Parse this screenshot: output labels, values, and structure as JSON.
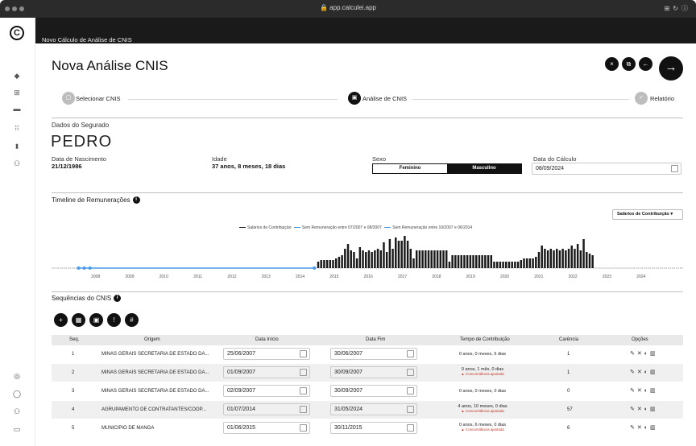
{
  "browser": {
    "url": "app.calculei.app"
  },
  "breadcrumb": "Novo Cálculo de Análise de CNIS",
  "page": {
    "title": "Nova Análise CNIS"
  },
  "header_buttons": {
    "close": "×",
    "copy": "⧉",
    "back": "←",
    "next": "→"
  },
  "steps": [
    {
      "label": "Selecionar CNIS",
      "state": "done"
    },
    {
      "label": "Análise de CNIS",
      "state": "active"
    },
    {
      "label": "Relatório",
      "state": "pending"
    }
  ],
  "segurado": {
    "section_title": "Dados do Segurado",
    "name": "PEDRO",
    "birth_label": "Data de Nascimento",
    "birth_value": "21/12/1986",
    "age_label": "Idade",
    "age_value": "37 anos, 8 meses, 18 dias",
    "sex_label": "Sexo",
    "sex_options": [
      "Feminino",
      "Masculino"
    ],
    "sex_selected": "Masculino",
    "calc_date_label": "Data do Cálculo",
    "calc_date_value": "08/09/2024"
  },
  "timeline": {
    "title": "Timeline de Remunerações",
    "dropdown": "Salários de Contribuição ▾",
    "legend": [
      {
        "name": "Salários de Contribuição",
        "color": "#222222"
      },
      {
        "name": "Sem Remuneração entre 07/2007 e 08/2007",
        "color": "#4a9be8"
      },
      {
        "name": "Sem Remuneração entre 10/2007 e 06/2014",
        "color": "#4a9be8"
      }
    ],
    "years": [
      "2008",
      "2009",
      "2010",
      "2011",
      "2012",
      "2013",
      "2014",
      "2015",
      "2016",
      "2017",
      "2018",
      "2019",
      "2020",
      "2021",
      "2022",
      "2023",
      "2024"
    ]
  },
  "chart_data": {
    "type": "bar",
    "x_start": "2007-06",
    "x_end": "2024-09",
    "gap_line_from": "2007-07",
    "gap_line_to": "2014-06",
    "bars": [
      0.2,
      0.25,
      0.25,
      0.25,
      0.25,
      0.25,
      0.3,
      0.35,
      0.4,
      0.6,
      0.75,
      0.55,
      0.5,
      0.3,
      0.65,
      0.55,
      0.5,
      0.55,
      0.5,
      0.55,
      0.6,
      0.55,
      0.8,
      0.5,
      0.9,
      0.6,
      0.95,
      0.85,
      0.85,
      1.0,
      0.85,
      0.6,
      0.3,
      0.55,
      0.55,
      0.55,
      0.55,
      0.55,
      0.55,
      0.55,
      0.55,
      0.55,
      0.55,
      0.55,
      0.2,
      0.4,
      0.4,
      0.4,
      0.4,
      0.4,
      0.4,
      0.4,
      0.4,
      0.4,
      0.4,
      0.4,
      0.4,
      0.4,
      0.4,
      0.2,
      0.2,
      0.2,
      0.2,
      0.2,
      0.2,
      0.2,
      0.2,
      0.2,
      0.25,
      0.3,
      0.3,
      0.3,
      0.3,
      0.35,
      0.5,
      0.7,
      0.6,
      0.55,
      0.6,
      0.55,
      0.6,
      0.55,
      0.6,
      0.55,
      0.6,
      0.7,
      0.6,
      0.75,
      0.55,
      0.9,
      0.5,
      0.45,
      0.4
    ]
  },
  "sequencias": {
    "title": "Sequências do CNIS",
    "tools": [
      "+",
      "▦",
      "▣",
      "!",
      "#"
    ],
    "headers": [
      "Seq.",
      "Origem",
      "Data Início",
      "Data Fim",
      "Tempo de Contribuição",
      "Carência",
      "Opções"
    ],
    "rows": [
      {
        "seq": "1",
        "origem": "MINAS GERAIS SECRETARIA DE ESTADO DA...",
        "inicio": "25/06/2007",
        "fim": "30/06/2007",
        "tempo": "0 anos, 0 meses, 6 dias",
        "conc": "",
        "carencia": "1"
      },
      {
        "seq": "2",
        "origem": "MINAS GERAIS SECRETARIA DE ESTADO DA...",
        "inicio": "01/09/2007",
        "fim": "30/09/2007",
        "tempo": "0 anos, 1 mês, 0 dias",
        "conc": "▲ Concomitância ajustada",
        "carencia": "1"
      },
      {
        "seq": "3",
        "origem": "MINAS GERAIS SECRETARIA DE ESTADO DA...",
        "inicio": "02/09/2007",
        "fim": "30/09/2007",
        "tempo": "0 anos, 0 meses, 0 dias",
        "conc": "",
        "carencia": "0"
      },
      {
        "seq": "4",
        "origem": "AGRUPAMENTO DE CONTRATANTES/COOP...",
        "inicio": "01/07/2014",
        "fim": "31/05/2024",
        "tempo": "4 anos, 10 meses, 0 dias",
        "conc": "▲ Concomitância ajustada",
        "carencia": "57"
      },
      {
        "seq": "5",
        "origem": "MUNICIPIO DE MANGA",
        "inicio": "01/06/2015",
        "fim": "30/11/2015",
        "tempo": "0 anos, 6 meses, 0 dias",
        "conc": "▲ Concomitância ajustada",
        "carencia": "6"
      }
    ],
    "option_icons": "✎ ✕ ◐ 🗑"
  }
}
